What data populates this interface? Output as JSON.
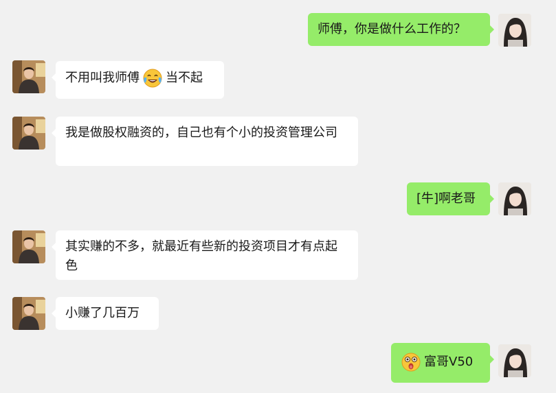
{
  "messages": [
    {
      "sender": "self",
      "text": "师傅，你是做什么工作的？"
    },
    {
      "sender": "other",
      "text_before": "不用叫我师傅",
      "emoji": "tears-of-joy-emoji",
      "text_after": "当不起"
    },
    {
      "sender": "other",
      "text": "我是做股权融资的，自己也有个小的投资管理公司"
    },
    {
      "sender": "self",
      "text": "[牛]啊老哥"
    },
    {
      "sender": "other",
      "text": "其实赚的不多，就最近有些新的投资项目才有点起色"
    },
    {
      "sender": "other",
      "text": "小赚了几百万"
    },
    {
      "sender": "self",
      "emoji": "astonished-face-emoji",
      "text": "富哥V50"
    }
  ],
  "colors": {
    "background": "#f1f1f1",
    "incoming_bubble": "#ffffff",
    "outgoing_bubble": "#95ec69",
    "text": "#191919"
  }
}
